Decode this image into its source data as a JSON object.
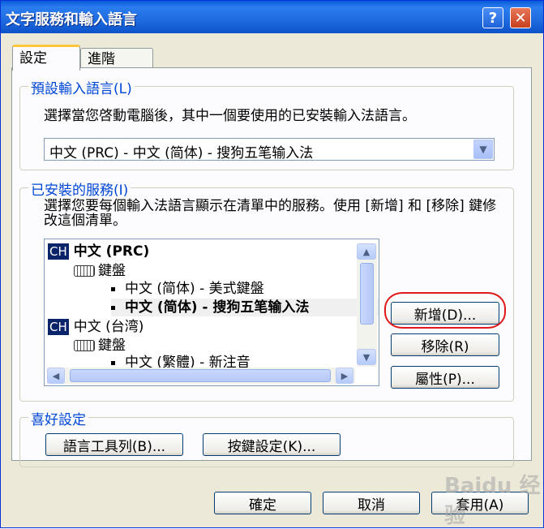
{
  "window": {
    "title": "文字服務和輸入語言"
  },
  "titlebar": {
    "help_glyph": "?",
    "close_glyph": "✕"
  },
  "tabs": [
    {
      "label": "設定"
    },
    {
      "label": "進階"
    }
  ],
  "default_language": {
    "group_label": "預設輸入語言(L)",
    "description": "選擇當您啓動電腦後，其中一個要使用的已安裝輸入法語言。",
    "selected": "中文 (PRC) - 中文 (简体) - 搜狗五笔输入法"
  },
  "installed_services": {
    "group_label": "已安裝的服務(I)",
    "description": "選擇您要每個輸入法語言顯示在清單中的服務。使用 [新增] 和 [移除] 鍵修改這個清單。",
    "list": {
      "lang1_badge": "CH",
      "lang1_label": "中文 (PRC)",
      "lang1_kbd": "鍵盤",
      "lang1_item1": "中文 (简体) - 美式鍵盤",
      "lang1_item2": "中文 (简体) - 搜狗五笔输入法",
      "lang2_badge": "CH",
      "lang2_label": "中文 (台湾)",
      "lang2_kbd": "鍵盤",
      "lang2_item1": "中文 (繁體) - 新注音"
    },
    "buttons": {
      "add": "新增(D)...",
      "remove": "移除(R)",
      "properties": "屬性(P)..."
    }
  },
  "preferences": {
    "group_label": "喜好設定",
    "language_bar": "語言工具列(B)...",
    "key_settings": "按鍵設定(K)..."
  },
  "footer": {
    "ok": "確定",
    "cancel": "取消",
    "apply": "套用(A)"
  },
  "watermark": "Baidu 经验"
}
